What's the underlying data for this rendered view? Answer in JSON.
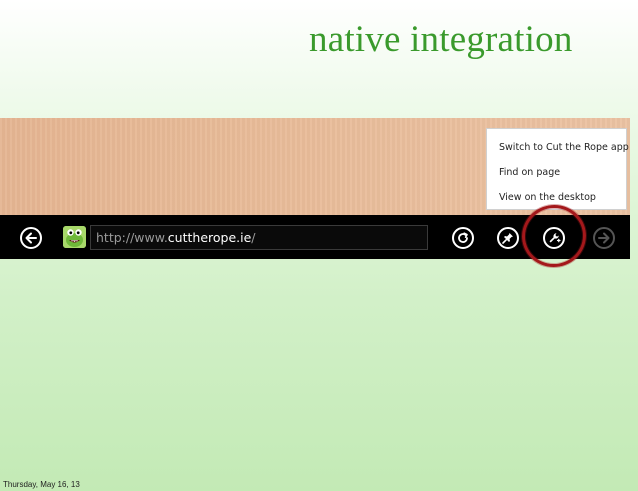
{
  "slide": {
    "title": "native integration",
    "footer_date": "Thursday, May 16, 13"
  },
  "browser": {
    "address_bar": {
      "url_prefix": "http://www.",
      "url_domain": "cuttherope.ie",
      "url_suffix": "/"
    },
    "buttons": {
      "back": "arrow-left-icon",
      "refresh": "refresh-icon",
      "pin": "pin-icon",
      "page_tools": "wrench-icon",
      "forward": "arrow-right-icon"
    },
    "page_tools_menu": {
      "items": [
        "Switch to Cut the Rope app",
        "Find on page",
        "View on the desktop"
      ]
    }
  },
  "colors": {
    "title": "#3a9a2c",
    "app_bar": "#000000",
    "highlight_ring": "#a4181b"
  }
}
